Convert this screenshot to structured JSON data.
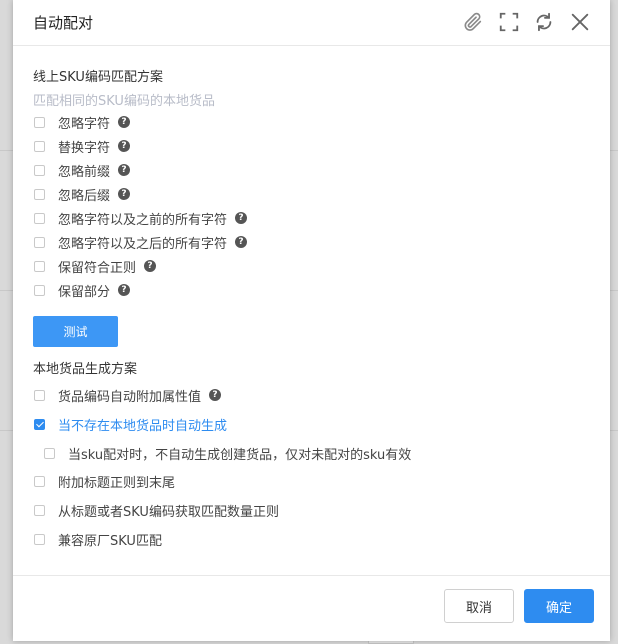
{
  "dialog": {
    "title": "自动配对",
    "icons": [
      "paperclip-icon",
      "fullscreen-icon",
      "refresh-icon",
      "close-icon"
    ]
  },
  "online_section": {
    "title": "线上SKU编码匹配方案",
    "hint": "匹配相同的SKU编码的本地货品",
    "options": [
      {
        "label": "忽略字符",
        "checked": false,
        "help": true
      },
      {
        "label": "替换字符",
        "checked": false,
        "help": true
      },
      {
        "label": "忽略前缀",
        "checked": false,
        "help": true
      },
      {
        "label": "忽略后缀",
        "checked": false,
        "help": true
      },
      {
        "label": "忽略字符以及之前的所有字符",
        "checked": false,
        "help": true
      },
      {
        "label": "忽略字符以及之后的所有字符",
        "checked": false,
        "help": true
      },
      {
        "label": "保留符合正则",
        "checked": false,
        "help": true
      },
      {
        "label": "保留部分",
        "checked": false,
        "help": true
      }
    ],
    "test_button": "测试"
  },
  "local_section": {
    "title": "本地货品生成方案",
    "options": [
      {
        "label": "货品编码自动附加属性值",
        "checked": false,
        "help": true
      },
      {
        "label": "当不存在本地货品时自动生成",
        "checked": true,
        "help": false
      },
      {
        "label": "当sku配对时，不自动生成创建货品，仅对未配对的sku有效",
        "checked": false,
        "help": false
      },
      {
        "label": "附加标题正则到末尾",
        "checked": false,
        "help": false
      },
      {
        "label": "从标题或者SKU编码获取匹配数量正则",
        "checked": false,
        "help": false
      },
      {
        "label": "兼容原厂SKU匹配",
        "checked": false,
        "help": false
      }
    ]
  },
  "footer": {
    "cancel_label": "取消",
    "ok_label": "确定"
  },
  "colors": {
    "primary": "#2e8cf0",
    "hint": "#b8bcc8"
  }
}
